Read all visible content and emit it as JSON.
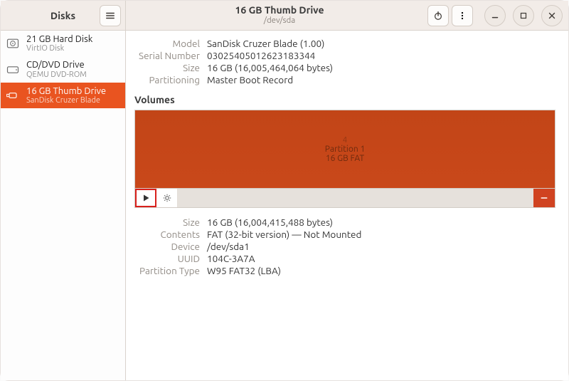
{
  "app_title": "Disks",
  "header": {
    "drive_title": "16 GB Thumb Drive",
    "drive_sub": "/dev/sda"
  },
  "sidebar": {
    "items": [
      {
        "title": "21 GB Hard Disk",
        "subtitle": "VirtIO Disk",
        "icon": "hdd"
      },
      {
        "title": "CD/DVD Drive",
        "subtitle": "QEMU DVD-ROM",
        "icon": "cd"
      },
      {
        "title": "16 GB Thumb Drive",
        "subtitle": "SanDisk Cruzer Blade",
        "icon": "usb"
      }
    ]
  },
  "drive_info_labels": {
    "model": "Model",
    "serial": "Serial Number",
    "size": "Size",
    "part": "Partitioning"
  },
  "drive_info": {
    "model": "SanDisk Cruzer Blade (1.00)",
    "serial": "03025405012623183344",
    "size": "16 GB (16,005,464,064 bytes)",
    "part": "Master Boot Record"
  },
  "volumes_title": "Volumes",
  "volume_block": {
    "top": "4",
    "name": "Partition 1",
    "desc": "16 GB FAT"
  },
  "partition_labels": {
    "size": "Size",
    "contents": "Contents",
    "device": "Device",
    "uuid": "UUID",
    "ptype": "Partition Type"
  },
  "partition": {
    "size": "16 GB (16,004,415,488 bytes)",
    "contents": "FAT (32-bit version) — Not Mounted",
    "device": "/dev/sda1",
    "uuid": "104C-3A7A",
    "ptype": "W95 FAT32 (LBA)"
  }
}
